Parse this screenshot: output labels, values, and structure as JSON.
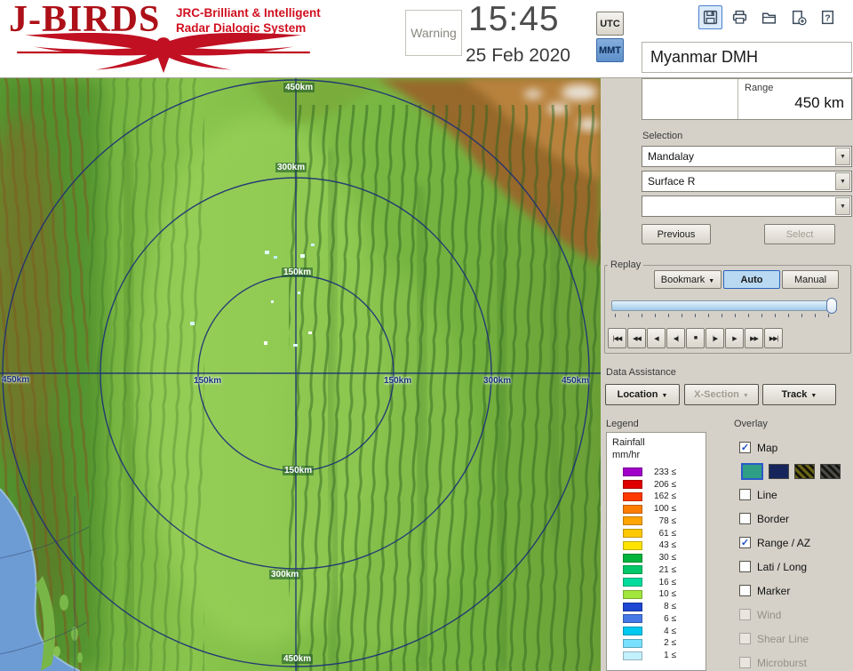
{
  "header": {
    "logo_title": "J-BIRDS",
    "logo_subtitle_line1": "JRC-Brilliant & Intelligent",
    "logo_subtitle_line2": "Radar  Dialogic  System",
    "warning_label": "Warning",
    "time": "15:45",
    "date": "25 Feb 2020",
    "utc_label": "UTC",
    "mmt_label": "MMT",
    "selected_timezone": "MMT",
    "org_name": "Myanmar DMH",
    "toolbar_icons": [
      "save-icon",
      "print-icon",
      "open-folder-icon",
      "export-icon",
      "help-icon"
    ],
    "toolbar_selected": "save-icon"
  },
  "range_panel": {
    "label": "Range",
    "value": "450 km"
  },
  "selection": {
    "label": "Selection",
    "combo_values": [
      "Mandalay",
      "Surface R",
      ""
    ],
    "previous_label": "Previous",
    "select_label": "Select",
    "select_enabled": false
  },
  "replay": {
    "group_label": "Replay",
    "bookmark_label": "Bookmark",
    "auto_label": "Auto",
    "manual_label": "Manual",
    "active_mode": "Auto",
    "slider_value_pct": 100,
    "playback_buttons": [
      "|◀◀",
      "◀◀",
      "◀",
      "◀|",
      "■",
      "|▶",
      "▶",
      "▶▶",
      "▶▶|"
    ]
  },
  "data_assistance": {
    "label": "Data Assistance",
    "location_label": "Location",
    "xsection_label": "X-Section",
    "track_label": "Track",
    "xsection_enabled": false
  },
  "legend": {
    "label": "Legend",
    "unit_line1": "Rainfall",
    "unit_line2": "mm/hr",
    "rows": [
      {
        "label": "233 ≤",
        "color": "#a000c8"
      },
      {
        "label": "206 ≤",
        "color": "#e00000"
      },
      {
        "label": "162 ≤",
        "color": "#ff3800"
      },
      {
        "label": "100 ≤",
        "color": "#ff7d00"
      },
      {
        "label": "78 ≤",
        "color": "#ffa400"
      },
      {
        "label": "61 ≤",
        "color": "#ffc800"
      },
      {
        "label": "43 ≤",
        "color": "#ffe400"
      },
      {
        "label": "30 ≤",
        "color": "#00b43c"
      },
      {
        "label": "21 ≤",
        "color": "#00c868"
      },
      {
        "label": "16 ≤",
        "color": "#00dc9b"
      },
      {
        "label": "10 ≤",
        "color": "#a0e63c"
      },
      {
        "label": "8 ≤",
        "color": "#1e46d2"
      },
      {
        "label": "6 ≤",
        "color": "#4678e6"
      },
      {
        "label": "4 ≤",
        "color": "#00c8f0"
      },
      {
        "label": "2 ≤",
        "color": "#78e1ff"
      },
      {
        "label": "1 ≤",
        "color": "#c3f0ff"
      }
    ]
  },
  "overlay": {
    "label": "Overlay",
    "items": [
      {
        "label": "Map",
        "checked": true,
        "disabled": false
      },
      {
        "swatches": [
          {
            "color": "#2f9e86",
            "selected": true
          },
          {
            "color": "#16265c"
          },
          {
            "color": "#6b6414",
            "pattern": true
          },
          {
            "color": "#4a4a4a",
            "pattern": true
          }
        ]
      },
      {
        "label": "Line",
        "checked": false,
        "disabled": false
      },
      {
        "label": "Border",
        "checked": false,
        "disabled": false
      },
      {
        "label": "Range / AZ",
        "checked": true,
        "disabled": false
      },
      {
        "label": "Lati / Long",
        "checked": false,
        "disabled": false
      },
      {
        "label": "Marker",
        "checked": false,
        "disabled": false
      },
      {
        "label": "Wind",
        "checked": false,
        "disabled": true
      },
      {
        "label": "Shear Line",
        "checked": false,
        "disabled": true
      },
      {
        "label": "Microburst",
        "checked": false,
        "disabled": true
      }
    ]
  },
  "map": {
    "range_labels": [
      "450km",
      "300km",
      "150km",
      "150km",
      "300km",
      "450km",
      "450km",
      "150km",
      "150km",
      "300km",
      "450km"
    ]
  }
}
